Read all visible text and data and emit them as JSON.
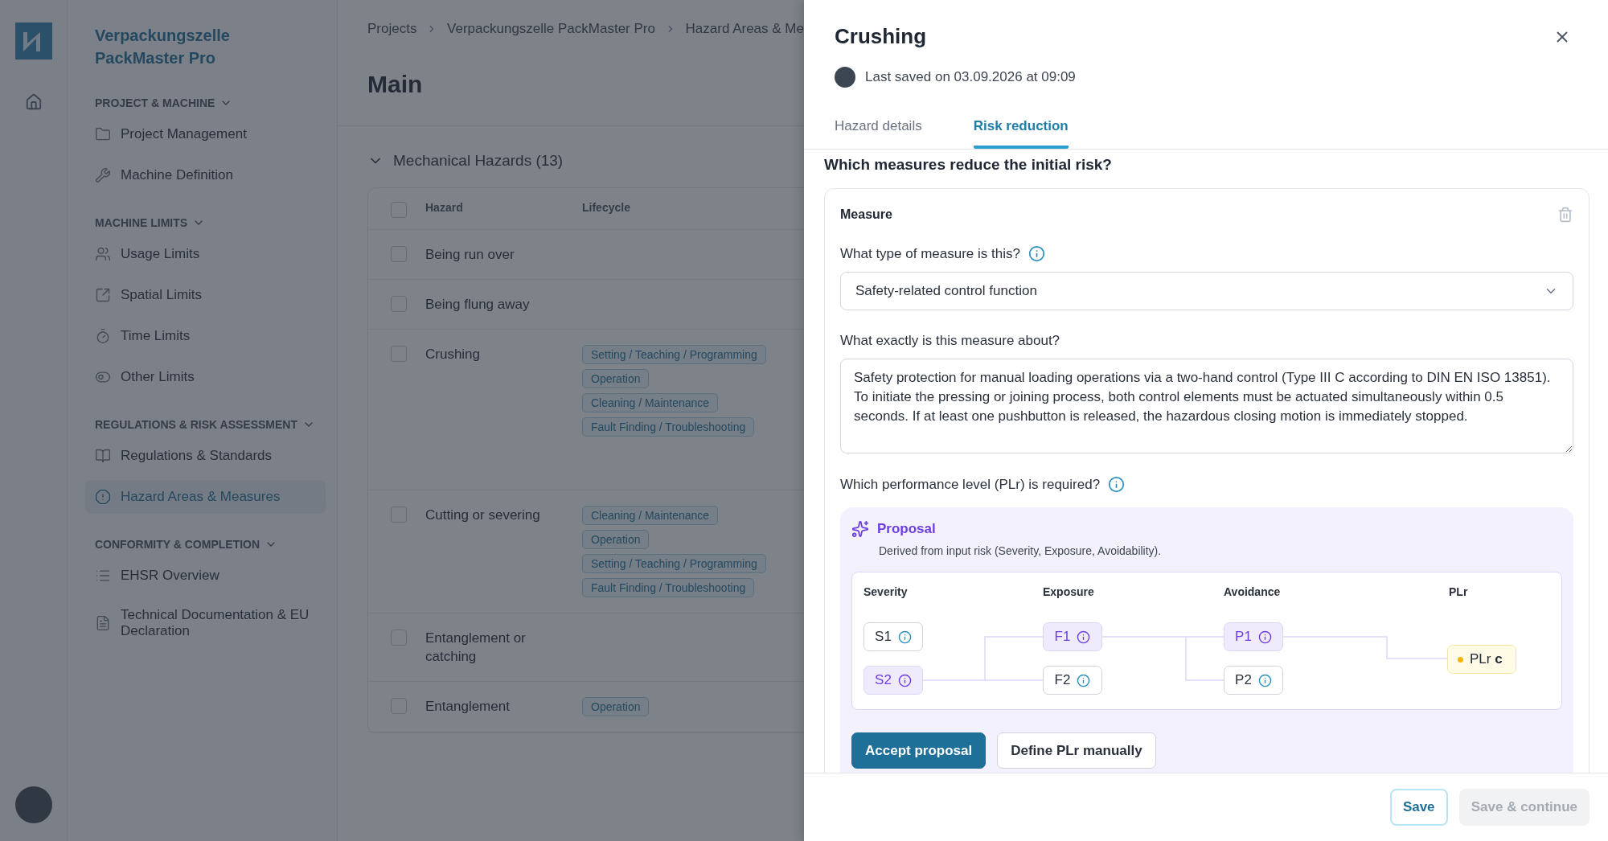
{
  "app": {
    "project_title": "Verpackungszelle PackMaster Pro"
  },
  "sidebar": {
    "sections": [
      {
        "title": "PROJECT & MACHINE",
        "expanded": true,
        "items": [
          {
            "label": "Project Management",
            "selected": false
          },
          {
            "label": "Machine Definition",
            "selected": false
          }
        ]
      },
      {
        "title": "MACHINE LIMITS",
        "expanded": true,
        "items": [
          {
            "label": "Usage Limits",
            "selected": false
          },
          {
            "label": "Spatial Limits",
            "selected": false
          },
          {
            "label": "Time Limits",
            "selected": false
          },
          {
            "label": "Other Limits",
            "selected": false
          }
        ]
      },
      {
        "title": "REGULATIONS & RISK ASSESSMENT",
        "expanded": true,
        "items": [
          {
            "label": "Regulations & Standards",
            "selected": false
          },
          {
            "label": "Hazard Areas & Measures",
            "selected": true
          }
        ]
      },
      {
        "title": "CONFORMITY & COMPLETION",
        "expanded": true,
        "items": [
          {
            "label": "EHSR Overview",
            "selected": false
          },
          {
            "label": "Technical Documentation & EU Declaration",
            "selected": false
          }
        ]
      }
    ]
  },
  "breadcrumb": [
    "Projects",
    "Verpackungszelle PackMaster Pro",
    "Hazard Areas & Me"
  ],
  "page_title": "Main",
  "section": {
    "title": "Mechanical Hazards (13)",
    "expanded": true,
    "header_checked": false,
    "columns": [
      "Hazard",
      "Lifecycle"
    ],
    "rows": [
      {
        "hazard": "Being run over",
        "checked": false,
        "lifecycle": []
      },
      {
        "hazard": "Being flung away",
        "checked": false,
        "lifecycle": []
      },
      {
        "hazard": "Crushing",
        "checked": false,
        "lifecycle": [
          "Setting / Teaching / Programming",
          "Operation",
          "Cleaning / Maintenance",
          "Fault Finding / Troubleshooting"
        ]
      },
      {
        "hazard": "Cutting or severing",
        "checked": false,
        "lifecycle": [
          "Cleaning / Maintenance",
          "Operation",
          "Setting / Teaching / Programming",
          "Fault Finding / Troubleshooting"
        ]
      },
      {
        "hazard": "Entanglement or catching",
        "checked": false,
        "lifecycle": []
      },
      {
        "hazard": "Entanglement",
        "checked": false,
        "lifecycle": [
          "Operation"
        ]
      }
    ]
  },
  "panel": {
    "title": "Crushing",
    "last_saved": "Last saved on 03.09.2026 at 09:09",
    "tabs": [
      {
        "label": "Hazard details",
        "selected": false
      },
      {
        "label": "Risk reduction",
        "selected": true
      }
    ],
    "question": "Which measures reduce the initial risk?",
    "measure": {
      "title": "Measure",
      "type_label": "What type of measure is this?",
      "type_value": "Safety-related control function",
      "about_label": "What exactly is this measure about?",
      "about_value": "Safety protection for manual loading operations via a two-hand control (Type III C according to DIN EN ISO 13851). To initiate the pressing or joining process, both control elements must be actuated simultaneously within 0.5 seconds. If at least one pushbutton is released, the hazardous closing motion is immediately stopped.",
      "plr_label": "Which performance level (PLr) is required?",
      "proposal": {
        "title": "Proposal",
        "subtitle": "Derived from input risk (Severity, Exposure, Avoidability).",
        "columns": [
          {
            "header": "Severity",
            "nodes": [
              {
                "label": "S1",
                "selected": false
              },
              {
                "label": "S2",
                "selected": true
              }
            ]
          },
          {
            "header": "Exposure",
            "nodes": [
              {
                "label": "F1",
                "selected": true
              },
              {
                "label": "F2",
                "selected": false
              }
            ]
          },
          {
            "header": "Avoidance",
            "nodes": [
              {
                "label": "P1",
                "selected": true
              },
              {
                "label": "P2",
                "selected": false
              }
            ]
          }
        ],
        "result": {
          "header": "PLr",
          "label": "PLr **c**"
        },
        "buttons": [
          {
            "label": "Accept proposal",
            "kind": "primary"
          },
          {
            "label": "Define PLr manually",
            "kind": "secondary"
          }
        ]
      }
    },
    "footer": [
      {
        "label": "Save",
        "disabled": false
      },
      {
        "label": "Save & continue",
        "disabled": true
      }
    ]
  }
}
